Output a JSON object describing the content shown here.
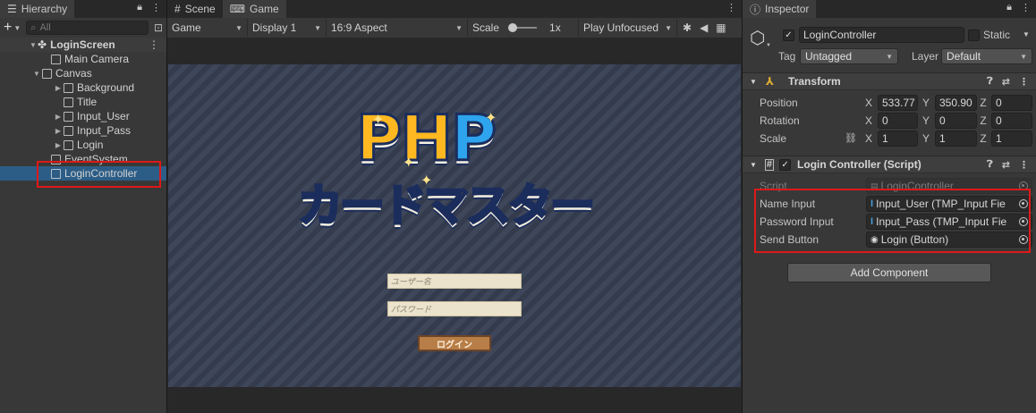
{
  "hierarchy": {
    "tab_label": "Hierarchy",
    "search_placeholder": "All",
    "scene_name": "LoginScreen",
    "items": [
      {
        "label": "Main Camera"
      },
      {
        "label": "Canvas"
      },
      {
        "label": "Background"
      },
      {
        "label": "Title"
      },
      {
        "label": "Input_User"
      },
      {
        "label": "Input_Pass"
      },
      {
        "label": "Login"
      },
      {
        "label": "EventSystem"
      },
      {
        "label": "LoginController"
      }
    ]
  },
  "game": {
    "scene_tab": "Scene",
    "game_tab": "Game",
    "mode": "Game",
    "display": "Display 1",
    "aspect": "16:9 Aspect",
    "scale_label": "Scale",
    "scale_value": "1x",
    "play_mode": "Play Unfocused",
    "logo_top": "PHP",
    "logo_bottom": "カードマスター",
    "username_placeholder": "ユーザー名",
    "password_placeholder": "パスワード",
    "login_button": "ログイン"
  },
  "inspector": {
    "tab_label": "Inspector",
    "object_name": "LoginController",
    "static_label": "Static",
    "tag_label": "Tag",
    "tag_value": "Untagged",
    "layer_label": "Layer",
    "layer_value": "Default",
    "transform": {
      "title": "Transform",
      "position_label": "Position",
      "rotation_label": "Rotation",
      "scale_label": "Scale",
      "x": "X",
      "y": "Y",
      "z": "Z",
      "position": [
        "533.77",
        "350.90",
        "0"
      ],
      "rotation": [
        "0",
        "0",
        "0"
      ],
      "scale": [
        "1",
        "1",
        "1"
      ]
    },
    "script_component": {
      "title": "Login Controller (Script)",
      "script_label": "Script",
      "script_value": "LoginController",
      "name_input_label": "Name Input",
      "name_input_value": "Input_User (TMP_Input Fie",
      "password_input_label": "Password Input",
      "password_input_value": "Input_Pass (TMP_Input Fie",
      "send_button_label": "Send Button",
      "send_button_value": "Login (Button)"
    },
    "add_component": "Add Component"
  },
  "colors": {
    "selection": "#2c5d87",
    "highlight": "#e01818",
    "logo_orange": "#ff8a1a",
    "logo_blue": "#2ea4ee"
  }
}
